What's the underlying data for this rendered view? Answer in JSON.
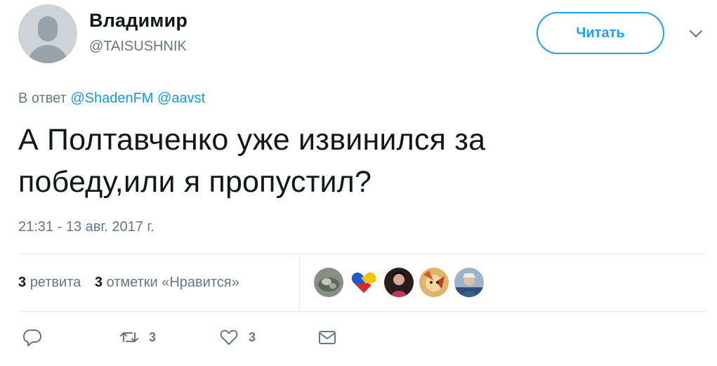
{
  "user": {
    "display_name": "Владимир",
    "handle": "@TAISUSHNIK"
  },
  "follow_button": {
    "label": "Читать"
  },
  "reply": {
    "prefix": "В ответ",
    "mentions": [
      "@ShadenFM",
      "@aavst"
    ]
  },
  "tweet": {
    "text_line1": "А Полтавченко уже извинился за",
    "text_line2": "победу,или я пропустил?",
    "timestamp": "21:31 - 13 авг. 2017 г."
  },
  "stats": {
    "retweets_count": "3",
    "retweets_label": "ретвита",
    "likes_count": "3",
    "likes_label": "отметки «Нравится»"
  },
  "actions": {
    "reply_count": "",
    "retweet_count": "3",
    "like_count": "3"
  },
  "colors": {
    "accent": "#1da1f2",
    "muted": "#657786",
    "text": "#14171a"
  }
}
